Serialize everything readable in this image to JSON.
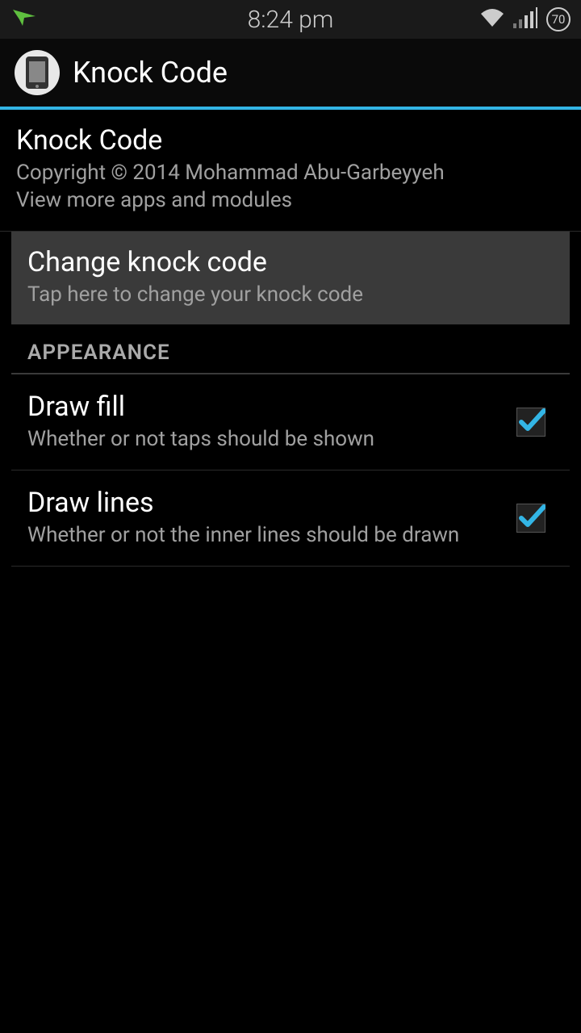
{
  "status": {
    "time": "8:24 pm",
    "battery": "70"
  },
  "app": {
    "title": "Knock Code"
  },
  "about": {
    "title": "Knock Code",
    "copyright": "Copyright © 2014 Mohammad Abu-Garbeyyeh",
    "more": "View more apps and modules"
  },
  "change": {
    "title": "Change knock code",
    "sub": "Tap here to change your knock code"
  },
  "section": {
    "appearance": "APPEARANCE"
  },
  "drawFill": {
    "title": "Draw fill",
    "sub": "Whether or not taps should be shown"
  },
  "drawLines": {
    "title": "Draw lines",
    "sub": "Whether or not the inner lines should be drawn"
  }
}
